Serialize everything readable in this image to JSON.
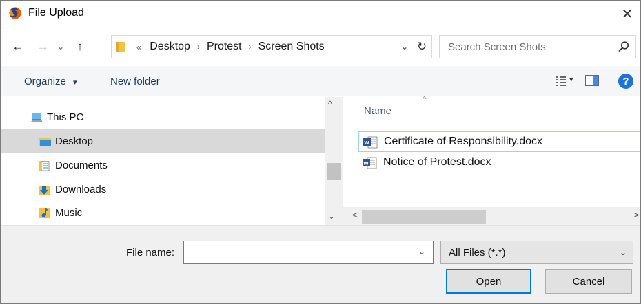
{
  "window": {
    "title": "File Upload",
    "icon": "firefox-icon",
    "close_glyph": "✕"
  },
  "nav": {
    "back_glyph": "←",
    "forward_glyph": "→",
    "recent_glyph": "⌄",
    "up_glyph": "↑",
    "overflow_glyph": "«",
    "breadcrumbs": [
      "Desktop",
      "Protest",
      "Screen Shots"
    ],
    "separator_glyph": "›",
    "address_dropdown_glyph": "⌄",
    "refresh_glyph": "↻"
  },
  "search": {
    "placeholder": "Search Screen Shots",
    "value": ""
  },
  "toolbar": {
    "organize_label": "Organize",
    "organize_caret": "▾",
    "new_folder_label": "New folder",
    "view_caret": "▾",
    "help_glyph": "?"
  },
  "sidebar": {
    "items": [
      {
        "label": "This PC",
        "icon": "computer-icon",
        "selected": false
      },
      {
        "label": "Desktop",
        "icon": "desktop-folder-icon",
        "selected": true
      },
      {
        "label": "Documents",
        "icon": "documents-folder-icon",
        "selected": false
      },
      {
        "label": "Downloads",
        "icon": "downloads-folder-icon",
        "selected": false
      },
      {
        "label": "Music",
        "icon": "music-folder-icon",
        "selected": false
      }
    ],
    "scroll_up_glyph": "^",
    "scroll_down_glyph": "⌄"
  },
  "files": {
    "column_header": "Name",
    "sort_glyph": "^",
    "rows": [
      {
        "name": "Certificate of Responsibility.docx",
        "icon": "word-document-icon"
      },
      {
        "name": "Notice of Protest.docx",
        "icon": "word-document-icon"
      }
    ],
    "scroll_left_glyph": "<",
    "scroll_right_glyph": ">"
  },
  "footer": {
    "file_name_label": "File name:",
    "file_name_value": "",
    "file_name_dropdown_glyph": "⌄",
    "filter_value": "All Files (*.*)",
    "filter_dropdown_glyph": "⌄",
    "open_label": "Open",
    "cancel_label": "Cancel"
  },
  "colors": {
    "accent": "#0078d7",
    "selection": "#d9d9d9",
    "hover_border": "#99d1ff",
    "toolbar_bg": "#f5f6f7",
    "footer_bg": "#f0f0f0",
    "help": "#1c74d8",
    "folder": "#f2c244",
    "word": "#2b579a"
  }
}
